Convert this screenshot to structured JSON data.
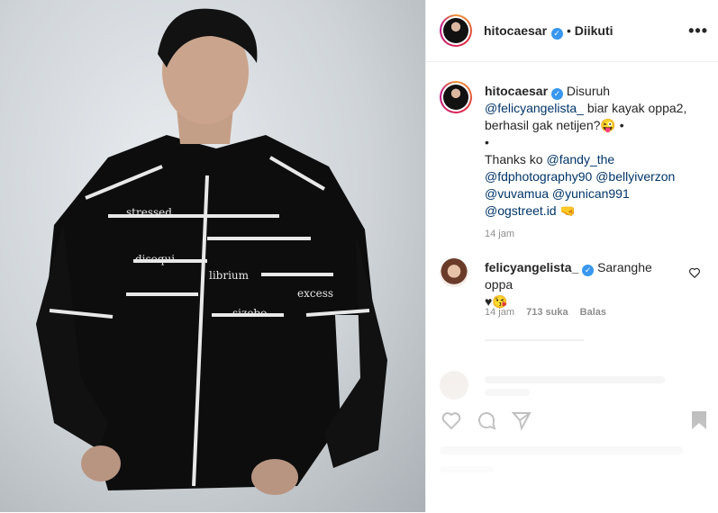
{
  "post": {
    "author": "hitocaesar",
    "follow_status": "Diikuti",
    "more_label": "•••"
  },
  "caption": {
    "author": "hitocaesar",
    "text1": "Disuruh",
    "mention1": "@felicyangelista_",
    "text2": "biar kayak oppa2, berhasil gak netijen?",
    "emoji1": "😜",
    "bullet1": "•",
    "bullet2": "•",
    "text3": "Thanks ko",
    "mention2": "@fandy_the",
    "mention3": "@fdphotography90",
    "mention4": "@bellyiverzon",
    "mention5": "@vuvamua",
    "mention6": "@yunican991",
    "mention7": "@ogstreet.id",
    "emoji2": "🤜",
    "time": "14 jam"
  },
  "comment": {
    "author": "felicyangelista_",
    "text": "Saranghe oppa",
    "emoji": "♥😘",
    "time": "14 jam",
    "likes": "713 suka",
    "reply": "Balas"
  },
  "colors": {
    "verified": "#3897f0",
    "mention": "#003569",
    "muted": "#8e8e8e"
  },
  "icons": [
    "more-options-icon",
    "verified-icon",
    "heart-icon",
    "comment-icon",
    "share-icon",
    "bookmark-icon"
  ]
}
